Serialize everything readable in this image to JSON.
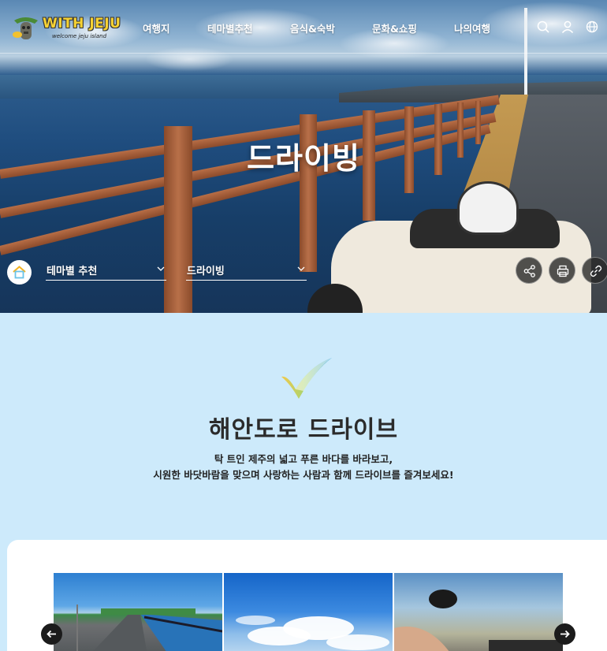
{
  "header": {
    "logo_text": "WITH JEJU",
    "logo_sub": "welcome jeju island",
    "nav": [
      "여행지",
      "테마별추천",
      "음식&숙박",
      "문화&쇼핑",
      "나의여행"
    ],
    "icons": [
      "search-icon",
      "user-icon",
      "globe-icon"
    ]
  },
  "hero": {
    "title": "드라이빙"
  },
  "breadcrumb": {
    "level1": "테마별 추천",
    "level2": "드라이빙"
  },
  "actions": [
    "share-icon",
    "print-icon",
    "link-icon"
  ],
  "section": {
    "title": "해안도로 드라이브",
    "desc_line1": "탁 트인 제주의 넓고 푸른 바다를 바라보고,",
    "desc_line2": "시원한 바닷바람을 맞으며 사랑하는 사람과 함께 드라이브를 즐겨보세요!"
  },
  "gallery": {
    "photos": [
      "coastal-road-photo",
      "blue-sky-photo",
      "scooter-ride-photo"
    ]
  },
  "colors": {
    "background": "#cdeafb",
    "logo_yellow": "#f6d233",
    "title_dark": "#2b2b2b"
  }
}
